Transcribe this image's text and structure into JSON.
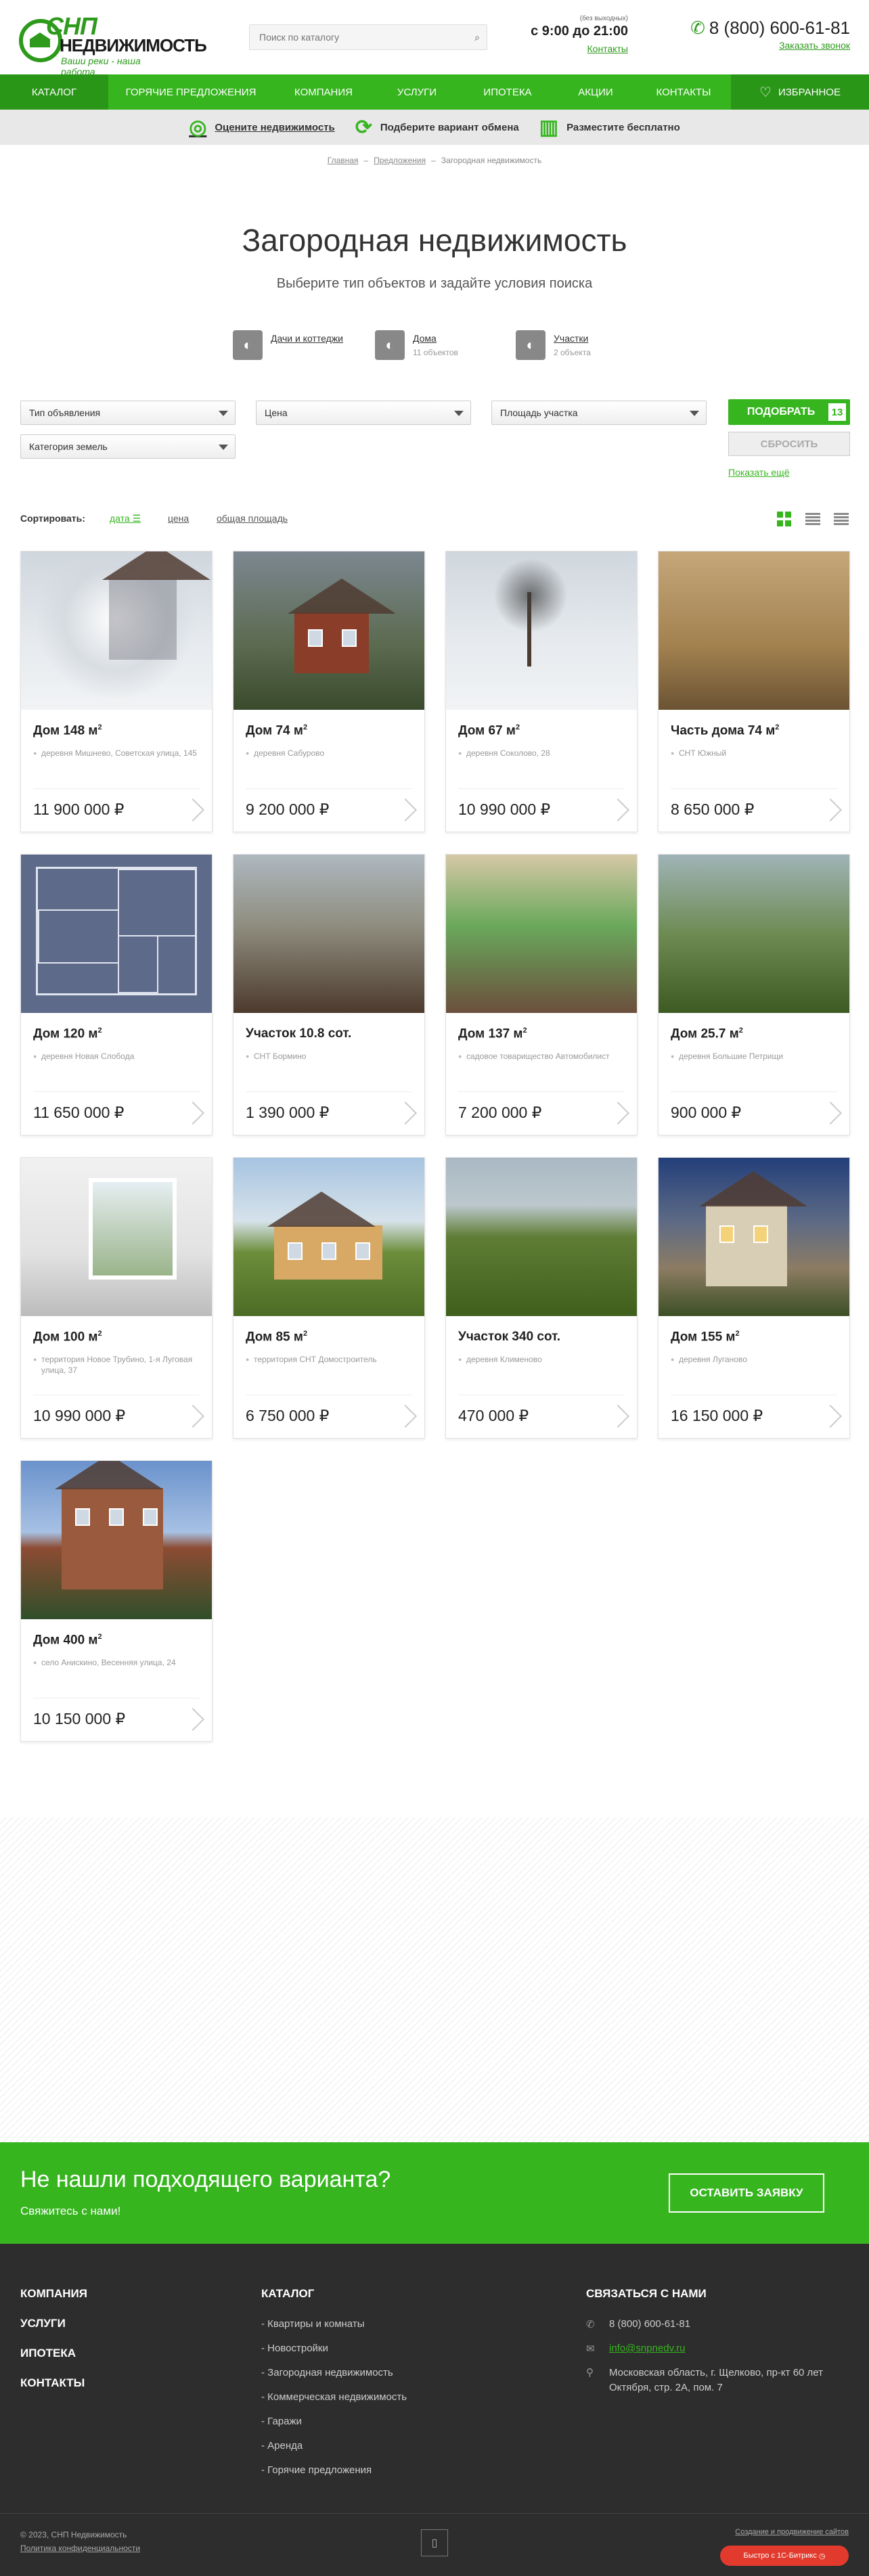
{
  "header": {
    "logo": {
      "line1": "СНП",
      "line2": "НЕДВИЖИМОСТЬ",
      "slogan": "Ваши реки - наша работа"
    },
    "search_placeholder": "Поиск по каталогу",
    "hours_note": "(без выходных)",
    "hours": "с 9:00 до 21:00",
    "contacts_link": "Контакты",
    "phone": "8 (800) 600-61-81",
    "callback": "Заказать звонок"
  },
  "nav": {
    "items": [
      "КАТАЛОГ",
      "ГОРЯЧИЕ ПРЕДЛОЖЕНИЯ",
      "КОМПАНИЯ",
      "УСЛУГИ",
      "ИПОТЕКА",
      "АКЦИИ",
      "КОНТАКТЫ"
    ],
    "favorites": "ИЗБРАННОЕ"
  },
  "subnav": [
    "Оцените недвижимость",
    "Подберите вариант обмена",
    "Разместите бесплатно"
  ],
  "breadcrumbs": [
    "Главная",
    "Предложения",
    "Загородная недвижимость"
  ],
  "title": "Загородная недвижимость",
  "subtitle": "Выберите тип объектов и задайте условия поиска",
  "types": [
    {
      "label": "Дачи и коттеджи",
      "count": ""
    },
    {
      "label": "Дома",
      "count": "11 объектов"
    },
    {
      "label": "Участки",
      "count": "2 объекта"
    }
  ],
  "filters": {
    "type": "Тип объявления",
    "price": "Цена",
    "area": "Площадь участка",
    "category": "Категория земель",
    "submit": "ПОДОБРАТЬ",
    "count": "13",
    "reset": "СБРОСИТЬ",
    "more": "Показать ещё"
  },
  "sort": {
    "label": "Сортировать:",
    "options": [
      "дата",
      "цена",
      "общая площадь"
    ]
  },
  "listings": [
    {
      "title": "Дом 148 м",
      "sup": "2",
      "address": "деревня Мишнево, Советская улица, 145",
      "price": "11 900 000 ₽"
    },
    {
      "title": "Дом 74 м",
      "sup": "2",
      "address": "деревня Сабурово",
      "price": "9 200 000 ₽"
    },
    {
      "title": "Дом 67 м",
      "sup": "2",
      "address": "деревня Соколово, 28",
      "price": "10 990 000 ₽"
    },
    {
      "title": "Часть дома 74 м",
      "sup": "2",
      "address": "СНТ Южный",
      "price": "8 650 000 ₽"
    },
    {
      "title": "Дом 120 м",
      "sup": "2",
      "address": "деревня Новая Слобода",
      "price": "11 650 000 ₽"
    },
    {
      "title": "Участок 10.8 сот.",
      "sup": "",
      "address": "СНТ Бормино",
      "price": "1 390 000 ₽"
    },
    {
      "title": "Дом 137 м",
      "sup": "2",
      "address": "садовое товарищество Автомобилист",
      "price": "7 200 000 ₽"
    },
    {
      "title": "Дом 25.7 м",
      "sup": "2",
      "address": "деревня Большие Петрищи",
      "price": "900 000 ₽"
    },
    {
      "title": "Дом 100 м",
      "sup": "2",
      "address": "территория Новое Трубино, 1-я Луговая улица, 37",
      "price": "10 990 000 ₽"
    },
    {
      "title": "Дом 85 м",
      "sup": "2",
      "address": "территория СНТ Домостроитель",
      "price": "6 750 000 ₽"
    },
    {
      "title": "Участок 340 сот.",
      "sup": "",
      "address": "деревня Клименово",
      "price": "470 000 ₽"
    },
    {
      "title": "Дом 155 м",
      "sup": "2",
      "address": "деревня Луганово",
      "price": "16 150 000 ₽"
    },
    {
      "title": "Дом 400 м",
      "sup": "2",
      "address": "село Анискино, Весенняя улица, 24",
      "price": "10 150 000 ₽"
    }
  ],
  "cta": {
    "title": "Не нашли подходящего варианта?",
    "subtitle": "Свяжитесь с нами!",
    "button": "ОСТАВИТЬ ЗАЯВКУ"
  },
  "footer": {
    "menu": [
      "КОМПАНИЯ",
      "УСЛУГИ",
      "ИПОТЕКА",
      "КОНТАКТЫ"
    ],
    "catalog_title": "КАТАЛОГ",
    "catalog": [
      "- Квартиры и комнаты",
      "- Новостройки",
      "- Загородная недвижимость",
      "- Коммерческая недвижимость",
      "- Гаражи",
      "- Аренда",
      "- Горячие предложения"
    ],
    "contact_title": "СВЯЗАТЬСЯ С НАМИ",
    "phone": "8 (800) 600-61-81",
    "email": "info@snpnedv.ru",
    "address": "Московская область, г. Щелково, пр-кт 60 лет Октября, стр. 2А, пом. 7",
    "copyright": "© 2023, СНП Недвижимость",
    "privacy": "Политика конфиденциальности",
    "dev": "Создание и продвижение сайтов",
    "bitrix": "Быстро с 1С-Битрикс"
  },
  "colors": {
    "brand_green": "#36b51f",
    "dark_green": "#2a9618",
    "footer_bg": "#2d2d2d"
  }
}
